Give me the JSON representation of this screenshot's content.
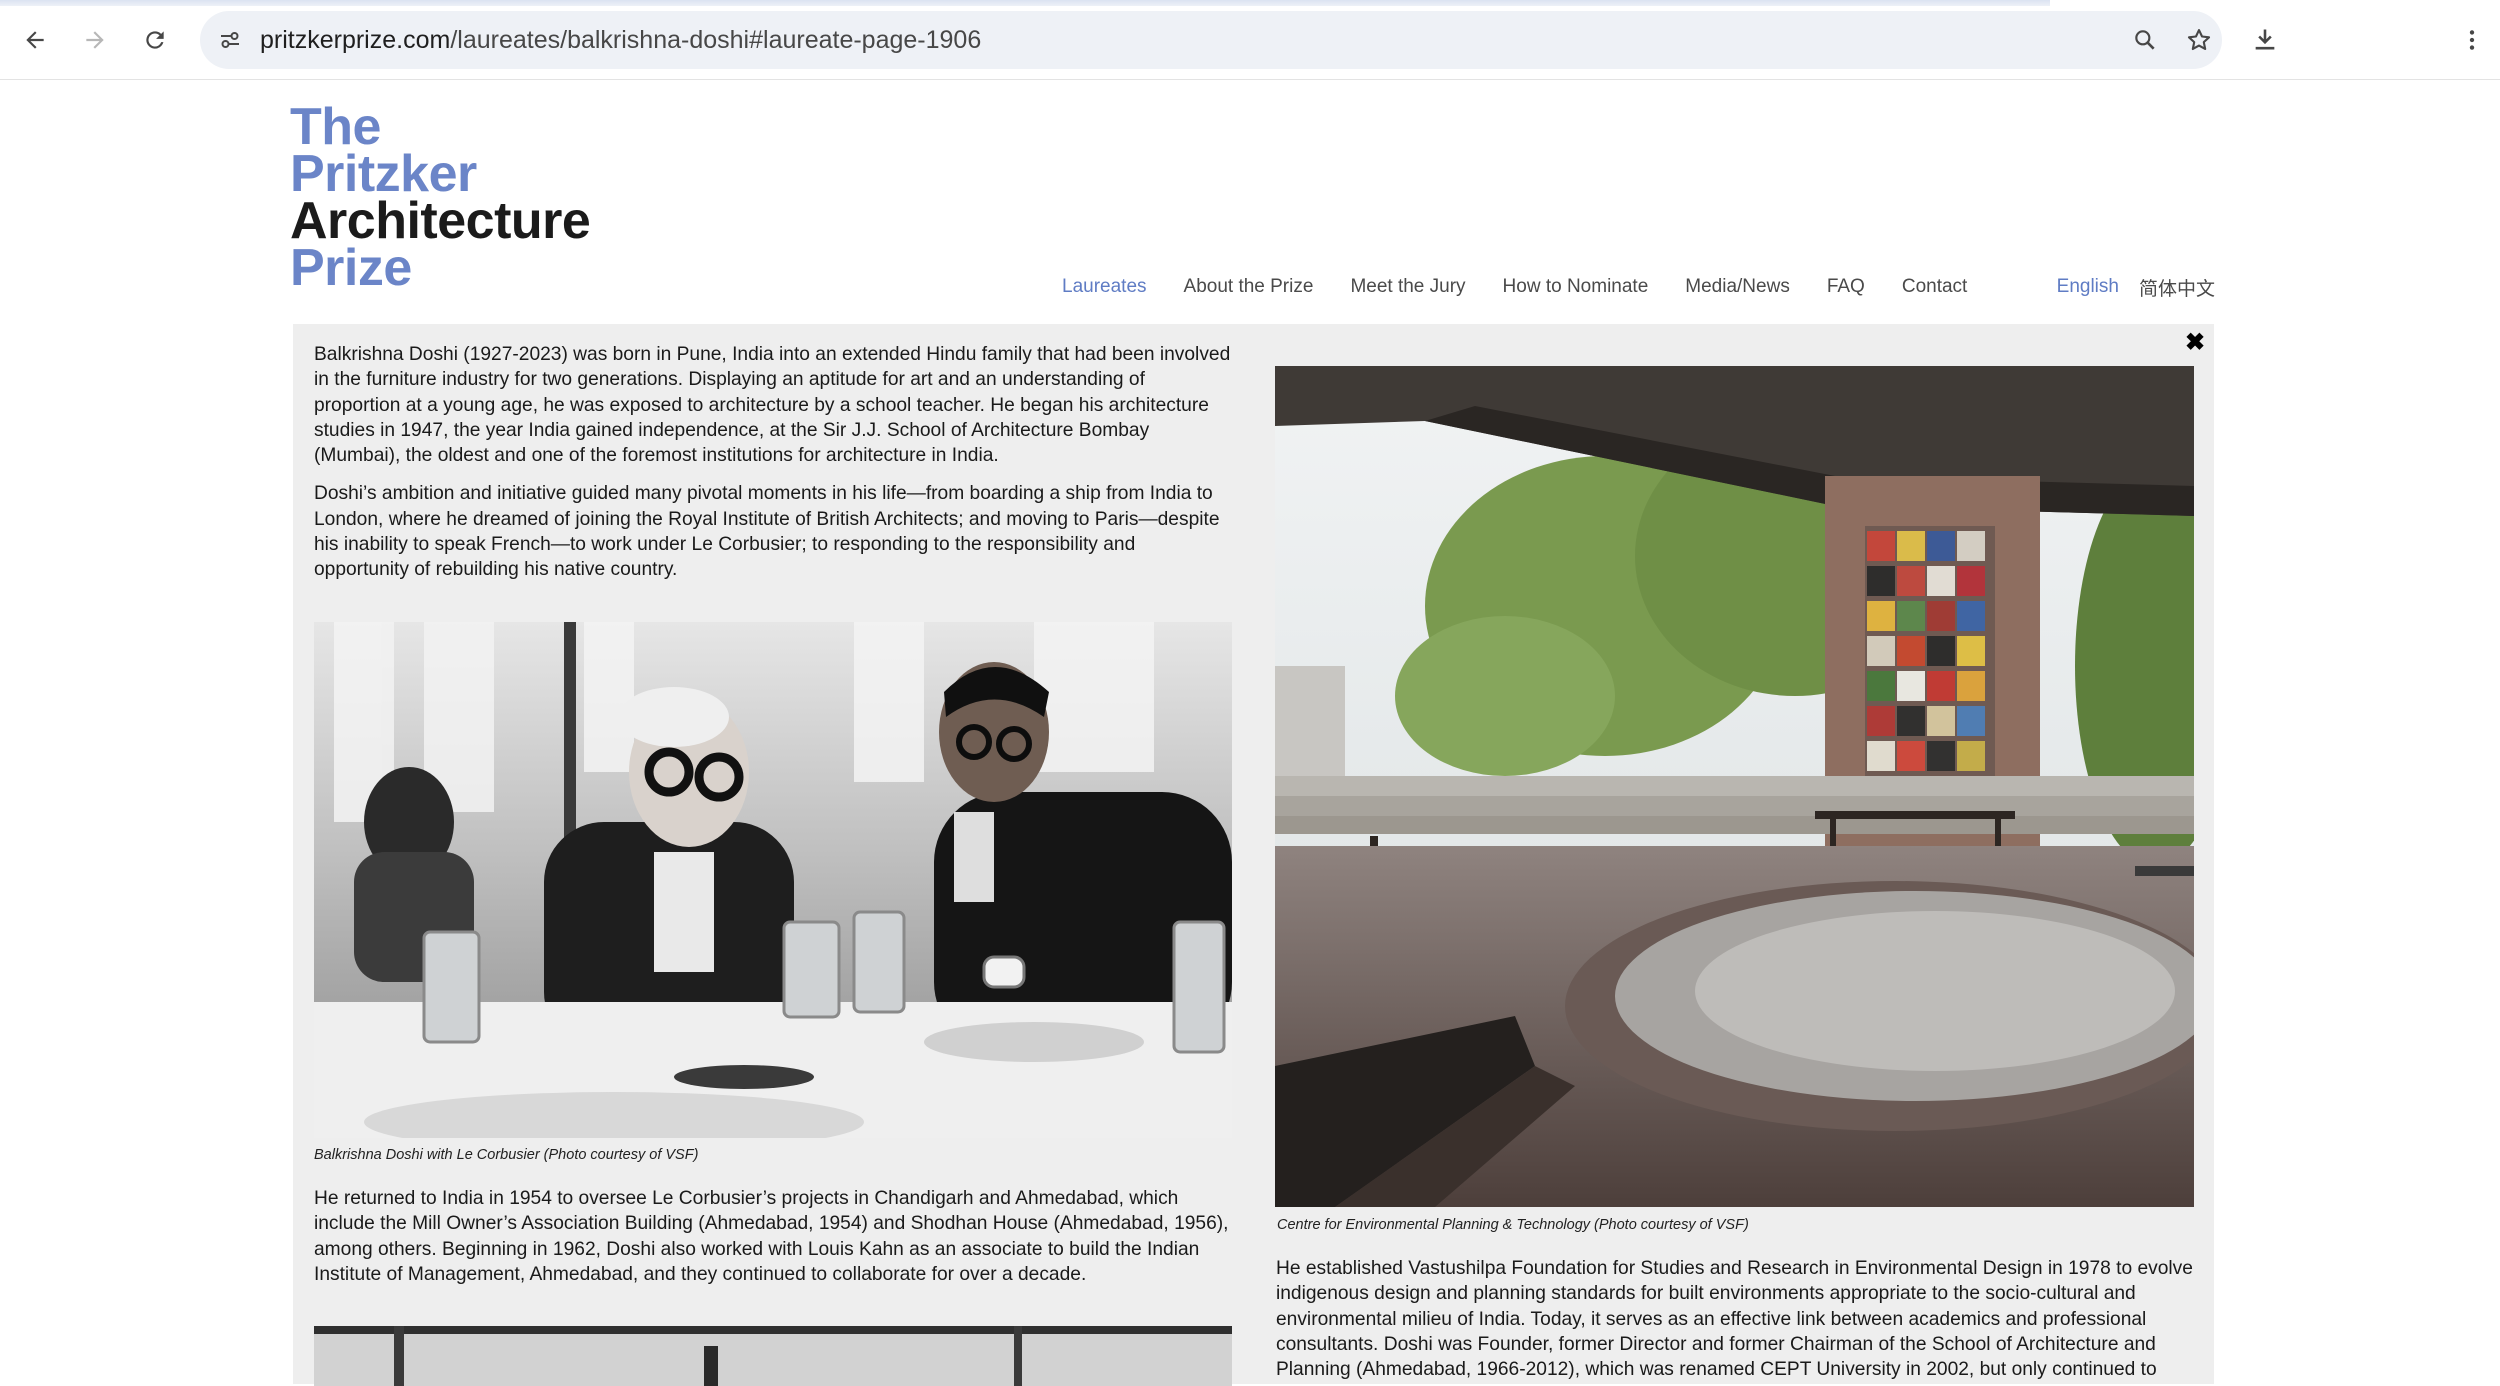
{
  "browser": {
    "url_domain": "pritzkerprize.com",
    "url_path": "/laureates/balkrishna-doshi#laureate-page-1906"
  },
  "logo": {
    "line1": "The",
    "line2": "Pritzker",
    "line3": "Architecture",
    "line4": "Prize"
  },
  "nav": {
    "items": [
      "Laureates",
      "About the Prize",
      "Meet the Jury",
      "How to Nominate",
      "Media/News",
      "FAQ",
      "Contact"
    ],
    "lang_en": "English",
    "lang_zh": "简体中文"
  },
  "close_label": "✖",
  "left": {
    "p1": "Balkrishna Doshi (1927-2023) was born in Pune, India into an extended Hindu family that had been involved in the furniture industry for two generations. Displaying an aptitude for art and an understanding of proportion at a young age, he was exposed to architecture by a school teacher. He began his architecture studies in 1947, the year India gained independence, at the Sir J.J. School of Architecture Bombay (Mumbai), the oldest and one of the foremost institutions for architecture in India.",
    "p2": "Doshi’s ambition and initiative guided many pivotal moments in his life—from boarding a ship from India to London, where he dreamed of joining the Royal Institute of British Architects; and moving to Paris—despite his inability to speak French—to work under Le Corbusier; to responding to the responsibility and opportunity of rebuilding his native country.",
    "caption1": "Balkrishna Doshi with Le Corbusier (Photo courtesy of VSF)",
    "p3": "He returned to India in 1954 to oversee Le Corbusier’s projects in Chandigarh and Ahmedabad, which include the Mill Owner’s Association Building (Ahmedabad, 1954) and Shodhan House (Ahmedabad, 1956), among others. Beginning in 1962, Doshi also worked with Louis Kahn as an associate to build the Indian Institute of Management, Ahmedabad, and they continued to collaborate for over a decade."
  },
  "right": {
    "caption2": "Centre for Environmental Planning & Technology (Photo courtesy of VSF)",
    "p4": "He established Vastushilpa Foundation for Studies and Research in Environmental Design in 1978 to evolve indigenous design and planning standards for built environments appropriate to the socio-cultural and environmental milieu of India. Today, it serves as an effective link between academics and professional consultants. Doshi was Founder, former Director and former Chairman of the School of Architecture and Planning (Ahmedabad, 1966-2012), which was renamed CEPT University in 2002, but only continued to"
  }
}
